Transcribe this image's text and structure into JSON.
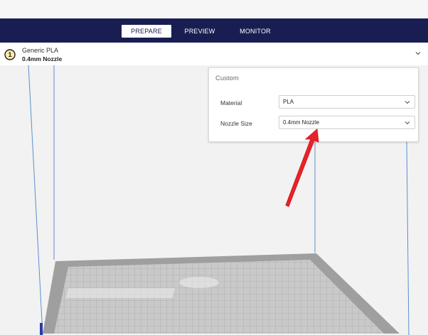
{
  "nav": {
    "tabs": [
      {
        "label": "PREPARE"
      },
      {
        "label": "PREVIEW"
      },
      {
        "label": "MONITOR"
      }
    ]
  },
  "printer": {
    "material_name": "Generic PLA",
    "nozzle": "0.4mm Nozzle",
    "extruder_number": "1"
  },
  "panel": {
    "title": "Custom",
    "material": {
      "label": "Material",
      "value": "PLA"
    },
    "nozzle_size": {
      "label": "Nozzle Size",
      "value": "0.4mm Nozzle"
    }
  },
  "colors": {
    "nav_bg": "#191e52",
    "arrow": "#e8222a",
    "panel_border": "#d9d9d9"
  }
}
